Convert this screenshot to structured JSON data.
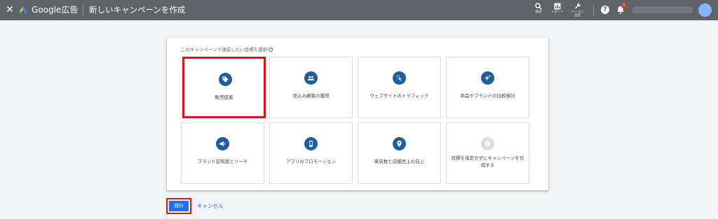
{
  "header": {
    "close_icon": "close-icon",
    "brand": "Google広告",
    "title": "新しいキャンペーンを作成",
    "tools": [
      {
        "label": "検索",
        "icon": "search-icon"
      },
      {
        "label": "レポート",
        "icon": "bar-chart-icon"
      },
      {
        "label": "ツールと設定",
        "icon": "wrench-icon"
      }
    ],
    "help_icon": "help-icon",
    "notification_badge": "!",
    "colors": {
      "bar": "#5f6368",
      "accent": "#1a73e8",
      "highlight": "#e0121b",
      "icon_bg": "#1f5e99"
    }
  },
  "main": {
    "prompt": "このキャンペーンで達成したい目標を選択",
    "goals": [
      {
        "label": "販売促進",
        "icon": "tag-icon",
        "selected": true
      },
      {
        "label": "見込み顧客の獲得",
        "icon": "people-icon",
        "selected": false
      },
      {
        "label": "ウェブサイトのトラフィック",
        "icon": "cursor-click-icon",
        "selected": false
      },
      {
        "label": "商品やブランドの比較検討",
        "icon": "sparkle-icon",
        "selected": false
      },
      {
        "label": "ブランド認知度とリーチ",
        "icon": "megaphone-icon",
        "selected": false
      },
      {
        "label": "アプリのプロモーション",
        "icon": "smartphone-icon",
        "selected": false
      },
      {
        "label": "来店数と店舗売上の向上",
        "icon": "location-pin-icon",
        "selected": false
      },
      {
        "label": "目標を指定せずにキャンペーンを作成する",
        "icon": "gear-icon",
        "selected": false
      }
    ]
  },
  "footer": {
    "continue_label": "続行",
    "cancel_label": "キャンセル"
  }
}
